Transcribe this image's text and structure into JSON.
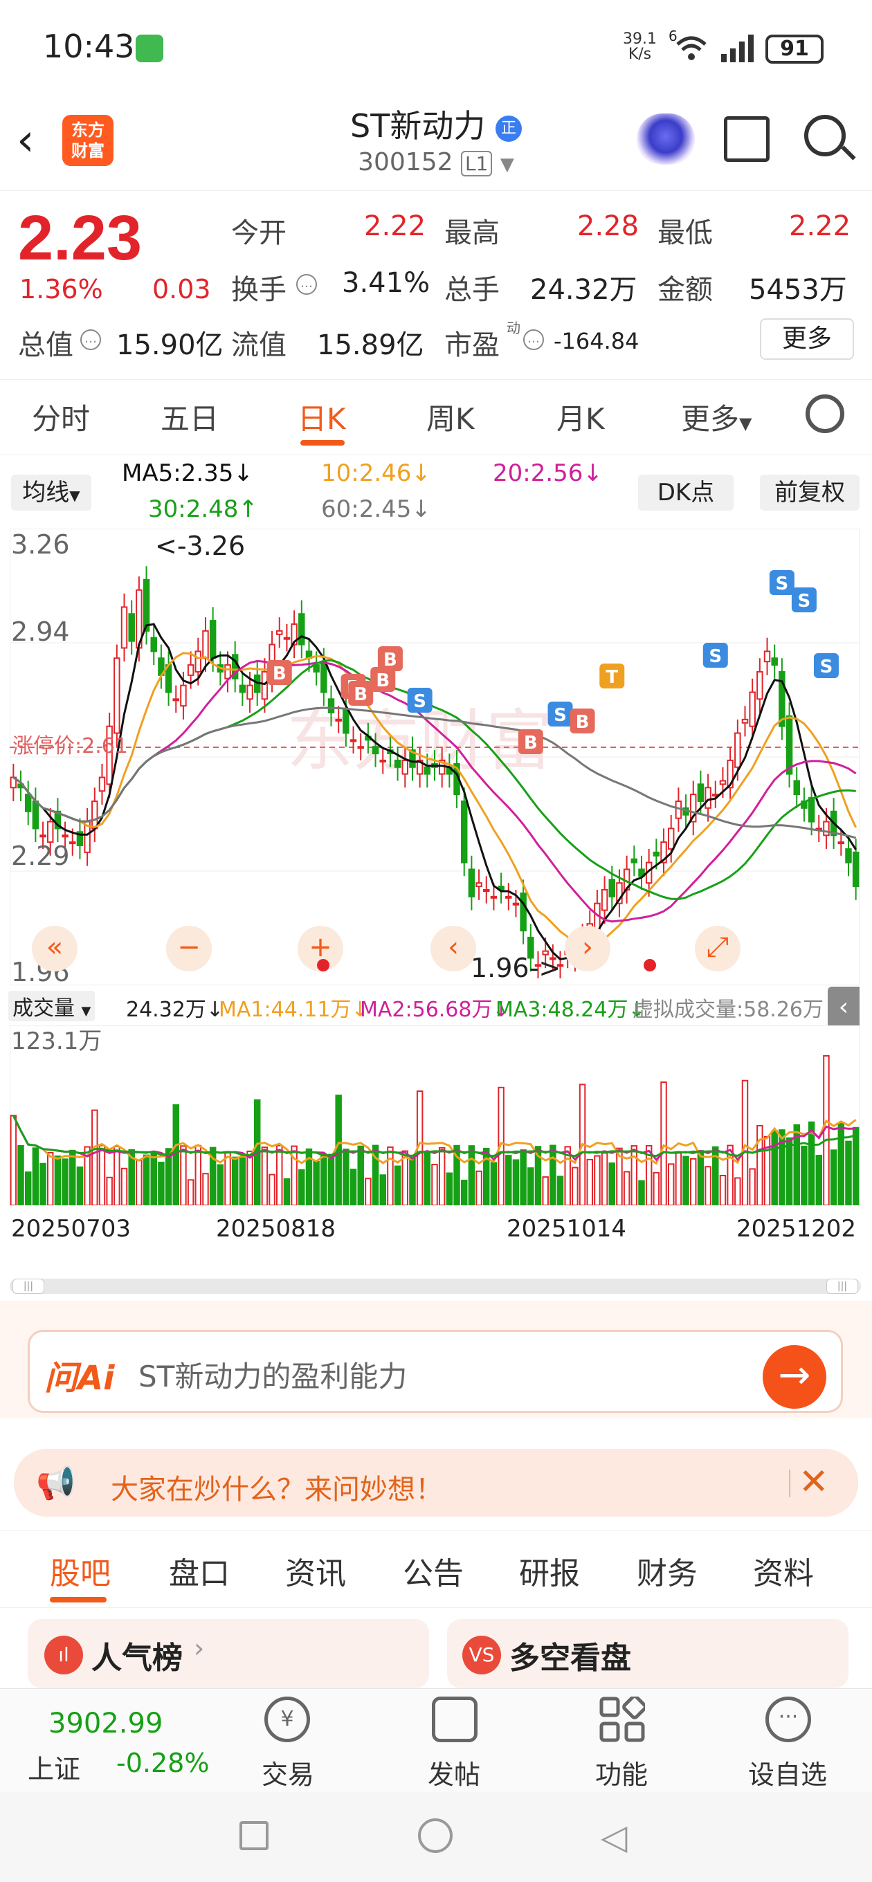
{
  "status": {
    "time": "10:43",
    "net_speed": "39.1",
    "net_unit": "K/s",
    "net_type": "6",
    "battery": "91"
  },
  "header": {
    "stock_name": "ST新动力",
    "badge": "正",
    "code": "300152",
    "level": "L1",
    "logo_text": "东方财富"
  },
  "quote": {
    "price": "2.23",
    "change_pct": "1.36%",
    "change": "0.03",
    "rows": [
      [
        {
          "label": "今开",
          "value": "2.22",
          "color": "red"
        },
        {
          "label": "最高",
          "value": "2.28",
          "color": "red"
        },
        {
          "label": "最低",
          "value": "2.22",
          "color": "red"
        }
      ],
      [
        {
          "label": "换手",
          "value": "3.41%",
          "color": "dark"
        },
        {
          "label": "总手",
          "value": "24.32万",
          "color": "dark"
        },
        {
          "label": "金额",
          "value": "5453万",
          "color": "dark"
        }
      ]
    ],
    "total_value_label": "总值",
    "total_value": "15.90亿",
    "float_value_label": "流值",
    "float_value": "15.89亿",
    "pe_label": "市盈",
    "pe_sup": "动",
    "pe_value": "-164.84",
    "more_label": "更多"
  },
  "period_tabs": [
    "分时",
    "五日",
    "日K",
    "周K",
    "月K",
    "更多"
  ],
  "active_period": "日K",
  "ma_legend": {
    "selector": "均线",
    "ma5": "MA5:2.35↓",
    "ma10": "10:2.46↓",
    "ma20": "20:2.56↓",
    "ma30": "30:2.48↑",
    "ma60": "60:2.45↓",
    "dk": "DK点",
    "fq": "前复权"
  },
  "chart_labels": {
    "y_top": "3.26",
    "y_2": "2.94",
    "y_3": "2.29",
    "y_bottom": "1.96",
    "max_note": "<-3.26",
    "min_note": "1.96->",
    "stop_price": "涨停价:2.61",
    "watermark": "东方财富"
  },
  "volume": {
    "selector": "成交量",
    "current": "24.32万↓",
    "ma1": "MA1:44.11万↓",
    "ma2": "MA2:56.68万↓",
    "ma3": "MA3:48.24万↓",
    "virtual": "虚拟成交量:58.26万",
    "max_label": "123.1万"
  },
  "dates": [
    "20250703",
    "20250818",
    "20251014",
    "20251202"
  ],
  "ai": {
    "logo": "问Ai",
    "query": "ST新动力的盈利能力"
  },
  "notice": {
    "text": "大家在炒什么？来问妙想！"
  },
  "bottom_tabs": [
    "股吧",
    "盘口",
    "资讯",
    "公告",
    "研报",
    "财务",
    "资料"
  ],
  "cards": [
    {
      "title": "人气榜",
      "icon": "ıl"
    },
    {
      "title": "多空看盘",
      "icon": "VS"
    }
  ],
  "bottom_bar": {
    "index_value": "3902.99",
    "index_name": "上证",
    "index_pct": "-0.28%",
    "items": [
      "交易",
      "发帖",
      "功能",
      "设自选"
    ]
  },
  "colors": {
    "up": "#e2242a",
    "down": "#16a016",
    "accent": "#f25a1a",
    "ma5": "#111111",
    "ma10": "#f0a020",
    "ma20": "#d0209a",
    "ma30": "#18a018",
    "ma60": "#777777"
  },
  "chart_data": {
    "type": "candlestick",
    "y_range": [
      1.96,
      3.26
    ],
    "close": [
      2.55,
      2.52,
      2.45,
      2.4,
      2.38,
      2.42,
      2.4,
      2.38,
      2.36,
      2.35,
      2.42,
      2.48,
      2.55,
      2.7,
      2.9,
      3.05,
      2.95,
      3.1,
      2.98,
      2.92,
      2.85,
      2.8,
      2.78,
      2.82,
      2.88,
      2.92,
      2.98,
      2.9,
      2.86,
      2.88,
      2.84,
      2.8,
      2.82,
      2.8,
      2.86,
      2.94,
      2.98,
      2.96,
      3.0,
      2.94,
      2.9,
      2.86,
      2.8,
      2.74,
      2.72,
      2.68,
      2.66,
      2.64,
      2.66,
      2.62,
      2.6,
      2.62,
      2.58,
      2.6,
      2.58,
      2.6,
      2.56,
      2.58,
      2.6,
      2.56,
      2.5,
      2.3,
      2.2,
      2.24,
      2.22,
      2.2,
      2.22,
      2.2,
      2.18,
      2.1,
      2.02,
      2.0,
      2.04,
      2.02,
      2.0,
      2.04,
      2.06,
      2.08,
      2.12,
      2.18,
      2.22,
      2.2,
      2.24,
      2.28,
      2.3,
      2.26,
      2.3,
      2.32,
      2.36,
      2.4,
      2.48,
      2.44,
      2.5,
      2.48,
      2.52,
      2.5,
      2.54,
      2.6,
      2.68,
      2.72,
      2.8,
      2.86,
      2.92,
      2.88,
      2.7,
      2.56,
      2.5,
      2.46,
      2.42,
      2.4,
      2.42,
      2.38,
      2.36,
      2.3,
      2.23
    ],
    "volume_max": "123.1万"
  }
}
